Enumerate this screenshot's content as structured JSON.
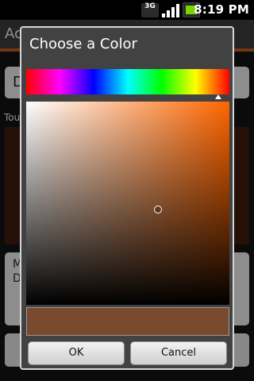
{
  "status_bar": {
    "network_label": "3G",
    "time": "8:19 PM"
  },
  "background_app": {
    "title": "Ac",
    "input1_text": "D",
    "label": "Tou",
    "input2_text_line1": "M",
    "input2_text_line2": "D"
  },
  "dialog": {
    "title": "Choose a Color",
    "hue_value": 0.945,
    "saturation_value": 0.65,
    "brightness_value": 0.47,
    "selected_color": "#7a4a2e",
    "ok_label": "OK",
    "cancel_label": "Cancel"
  },
  "colors": {
    "app_accent": "#b85a1e",
    "swatch_bg": "#3d1a0c",
    "sv_hue": "#ff6600"
  },
  "icons": [
    "3g-icon",
    "signal-icon",
    "battery-icon"
  ]
}
